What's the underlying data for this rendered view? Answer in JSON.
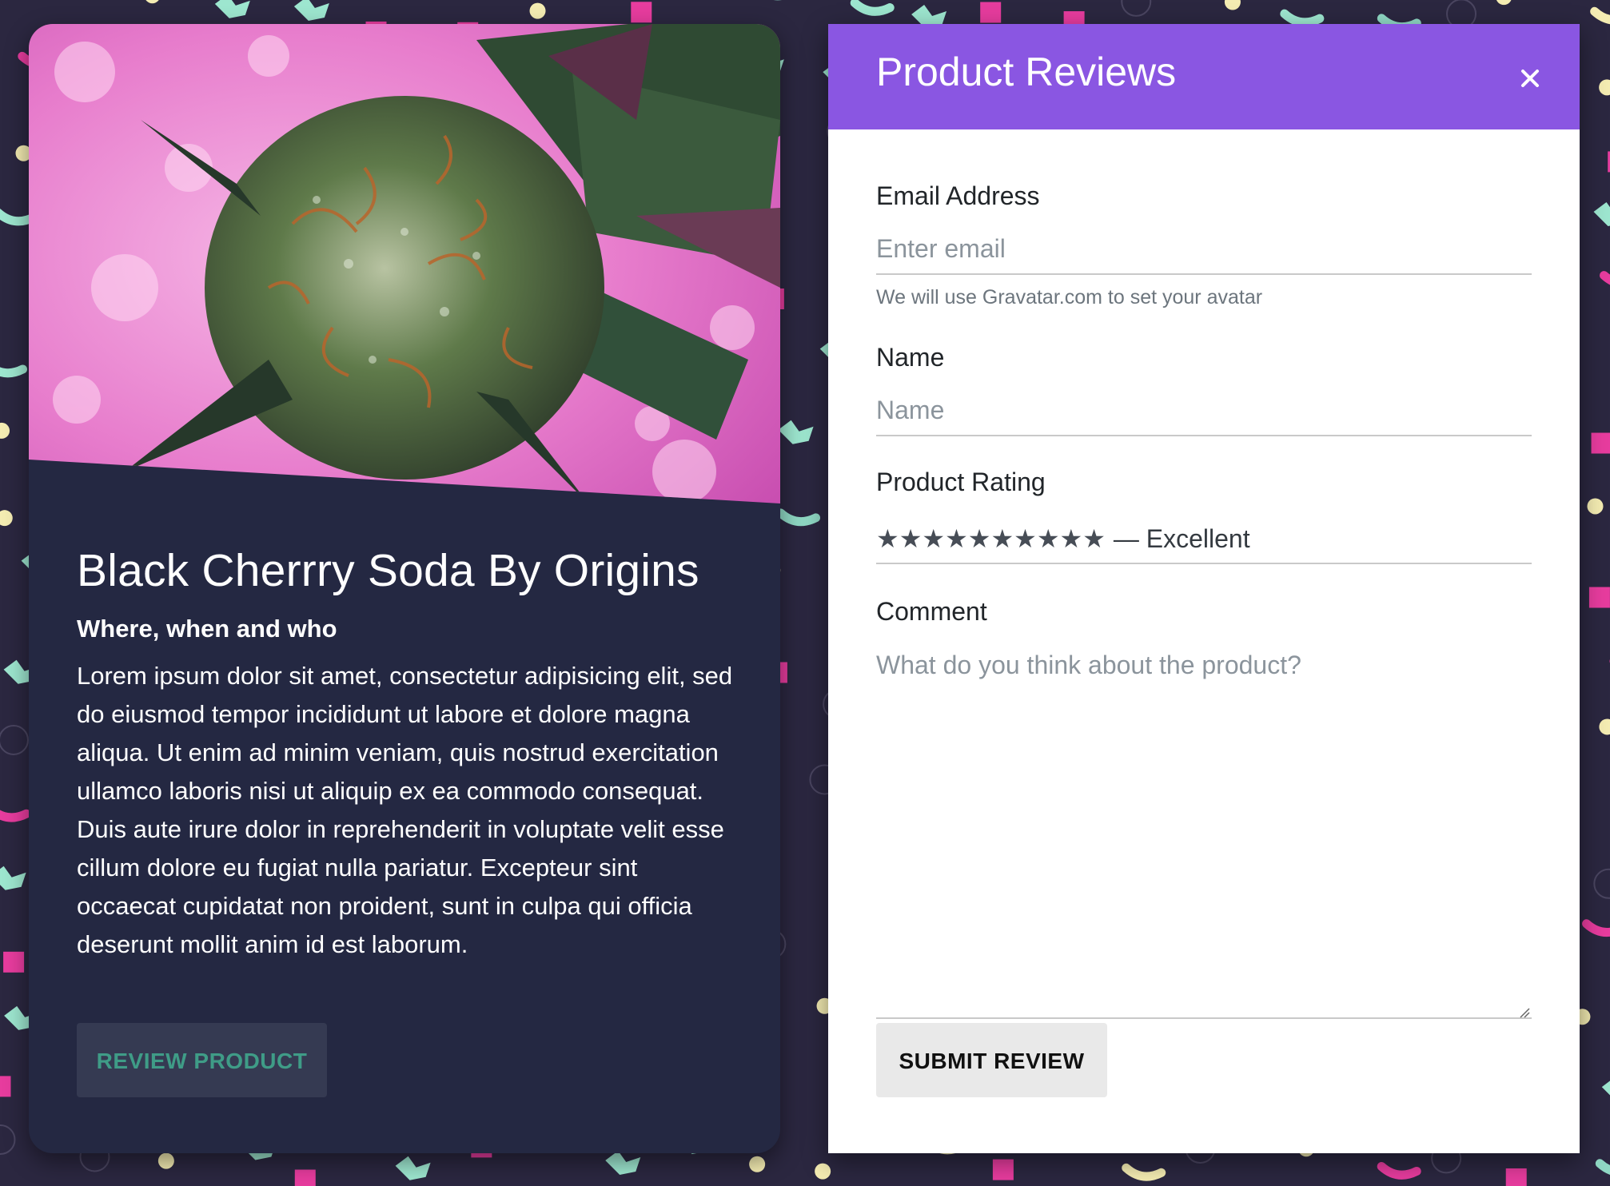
{
  "colors": {
    "page_background": "#2b2740",
    "card_background": "#242842",
    "header_accent": "#8a56e2",
    "review_button_text": "#3f9c87"
  },
  "product_card": {
    "image_alt": "cannabis-bud-photo",
    "title": "Black Cherrry Soda By Origins",
    "subtitle": "Where, when and who",
    "description": "Lorem ipsum dolor sit amet, consectetur adipisicing elit, sed do eiusmod tempor incididunt ut labore et dolore magna aliqua. Ut enim ad minim veniam, quis nostrud exercitation ullamco laboris nisi ut aliquip ex ea commodo consequat. Duis aute irure dolor in reprehenderit in voluptate velit esse cillum dolore eu fugiat nulla pariatur. Excepteur sint occaecat cupidatat non proident, sunt in culpa qui officia deserunt mollit anim id est laborum.",
    "review_button_label": "REVIEW PRODUCT"
  },
  "review_panel": {
    "title": "Product Reviews",
    "close_icon": "close-icon",
    "email": {
      "label": "Email Address",
      "placeholder": "Enter email",
      "value": "",
      "help": "We will use Gravatar.com to set your avatar"
    },
    "name": {
      "label": "Name",
      "placeholder": "Name",
      "value": ""
    },
    "rating": {
      "label": "Product Rating",
      "stars": 10,
      "max": 10,
      "text": "— Excellent"
    },
    "comment": {
      "label": "Comment",
      "placeholder": "What do you think about the product?",
      "value": ""
    },
    "submit_label": "SUBMIT REVIEW"
  }
}
